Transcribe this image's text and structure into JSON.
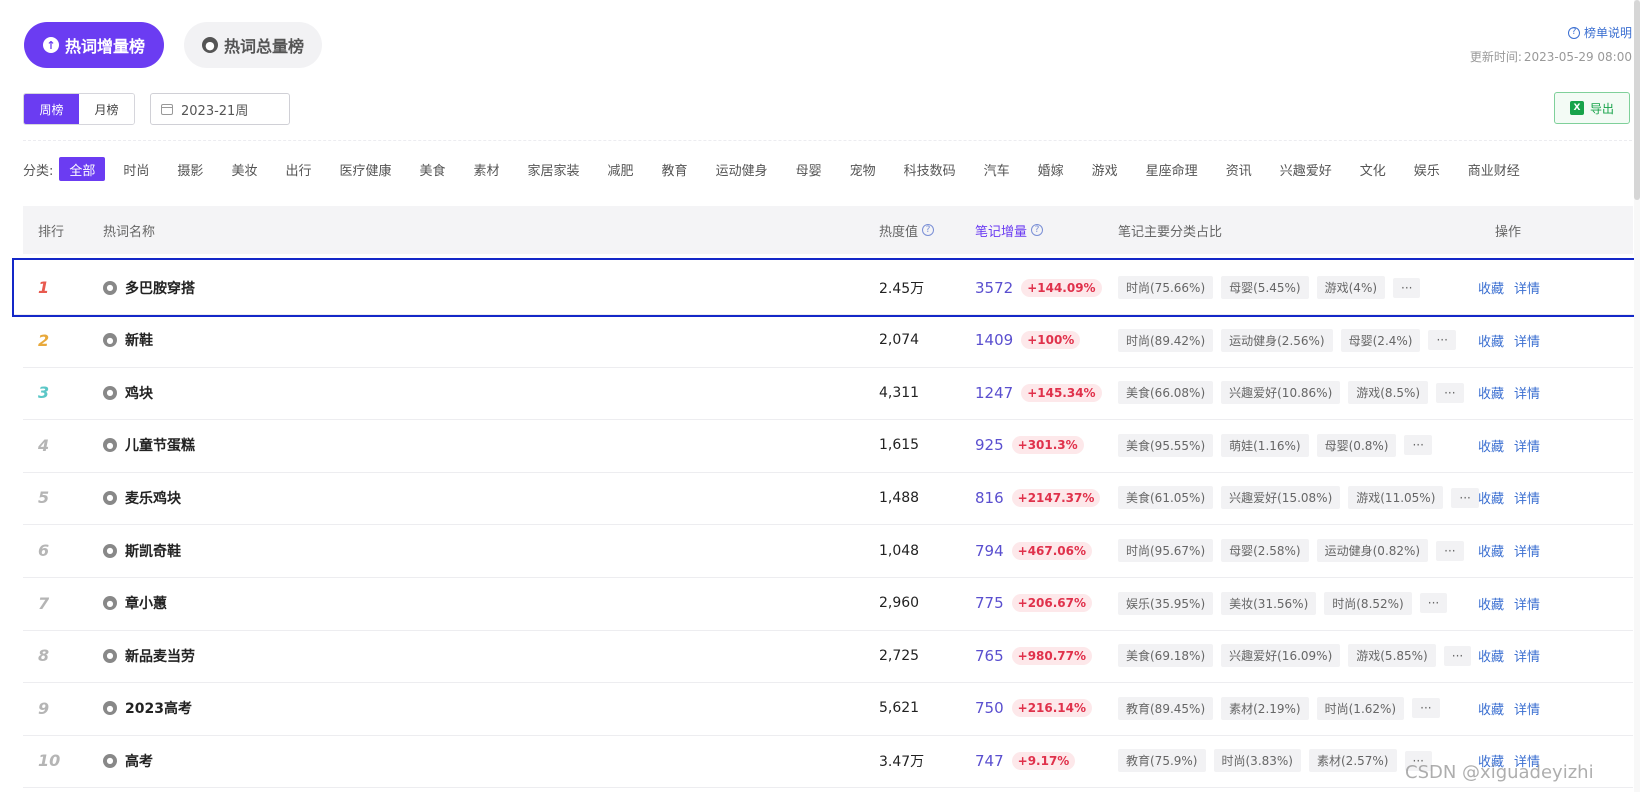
{
  "tabs": [
    {
      "label": "热词增量榜",
      "icon": "arrow-up-icon"
    },
    {
      "label": "热词总量榜",
      "icon": "flame-icon"
    }
  ],
  "header": {
    "rules_link": "榜单说明",
    "update_label": "更新时间:",
    "update_time": "2023-05-29 08:00"
  },
  "period": {
    "week": "周榜",
    "month": "月榜"
  },
  "week_picker": {
    "value": "2023-21周"
  },
  "export_label": "导出",
  "categories_label": "分类:",
  "categories": [
    "全部",
    "时尚",
    "摄影",
    "美妆",
    "出行",
    "医疗健康",
    "美食",
    "素材",
    "家居家装",
    "减肥",
    "教育",
    "运动健身",
    "母婴",
    "宠物",
    "科技数码",
    "汽车",
    "婚嫁",
    "游戏",
    "星座命理",
    "资讯",
    "兴趣爱好",
    "文化",
    "娱乐",
    "商业财经"
  ],
  "table": {
    "headers": {
      "rank": "排行",
      "keyword": "热词名称",
      "heat": "热度值",
      "increase": "笔记增量",
      "share": "笔记主要分类占比",
      "ops": "操作"
    },
    "ops_labels": {
      "favorite": "收藏",
      "detail": "详情"
    },
    "more_label": "···",
    "rows": [
      {
        "rank": "1",
        "keyword": "多巴胺穿搭",
        "heat": "2.45万",
        "inc": "3572",
        "pct": "+144.09%",
        "tags": [
          "时尚(75.66%)",
          "母婴(5.45%)",
          "游戏(4%)"
        ]
      },
      {
        "rank": "2",
        "keyword": "新鞋",
        "heat": "2,074",
        "inc": "1409",
        "pct": "+100%",
        "tags": [
          "时尚(89.42%)",
          "运动健身(2.56%)",
          "母婴(2.4%)"
        ]
      },
      {
        "rank": "3",
        "keyword": "鸡块",
        "heat": "4,311",
        "inc": "1247",
        "pct": "+145.34%",
        "tags": [
          "美食(66.08%)",
          "兴趣爱好(10.86%)",
          "游戏(8.5%)"
        ]
      },
      {
        "rank": "4",
        "keyword": "儿童节蛋糕",
        "heat": "1,615",
        "inc": "925",
        "pct": "+301.3%",
        "tags": [
          "美食(95.55%)",
          "萌娃(1.16%)",
          "母婴(0.8%)"
        ]
      },
      {
        "rank": "5",
        "keyword": "麦乐鸡块",
        "heat": "1,488",
        "inc": "816",
        "pct": "+2147.37%",
        "tags": [
          "美食(61.05%)",
          "兴趣爱好(15.08%)",
          "游戏(11.05%)"
        ]
      },
      {
        "rank": "6",
        "keyword": "斯凯奇鞋",
        "heat": "1,048",
        "inc": "794",
        "pct": "+467.06%",
        "tags": [
          "时尚(95.67%)",
          "母婴(2.58%)",
          "运动健身(0.82%)"
        ]
      },
      {
        "rank": "7",
        "keyword": "章小蕙",
        "heat": "2,960",
        "inc": "775",
        "pct": "+206.67%",
        "tags": [
          "娱乐(35.95%)",
          "美妆(31.56%)",
          "时尚(8.52%)"
        ]
      },
      {
        "rank": "8",
        "keyword": "新品麦当劳",
        "heat": "2,725",
        "inc": "765",
        "pct": "+980.77%",
        "tags": [
          "美食(69.18%)",
          "兴趣爱好(16.09%)",
          "游戏(5.85%)"
        ]
      },
      {
        "rank": "9",
        "keyword": "2023高考",
        "heat": "5,621",
        "inc": "750",
        "pct": "+216.14%",
        "tags": [
          "教育(89.45%)",
          "素材(2.19%)",
          "时尚(1.62%)"
        ]
      },
      {
        "rank": "10",
        "keyword": "高考",
        "heat": "3.47万",
        "inc": "747",
        "pct": "+9.17%",
        "tags": [
          "教育(75.9%)",
          "时尚(3.83%)",
          "素材(2.57%)"
        ]
      }
    ]
  },
  "colors": {
    "accent": "#6b3cf2",
    "rank1": "#e85a4f",
    "rank2": "#e8a93c",
    "rank3": "#5bc7c7",
    "rank_other": "#b5b5b5"
  },
  "watermark": "CSDN @xiguadeyizhi"
}
